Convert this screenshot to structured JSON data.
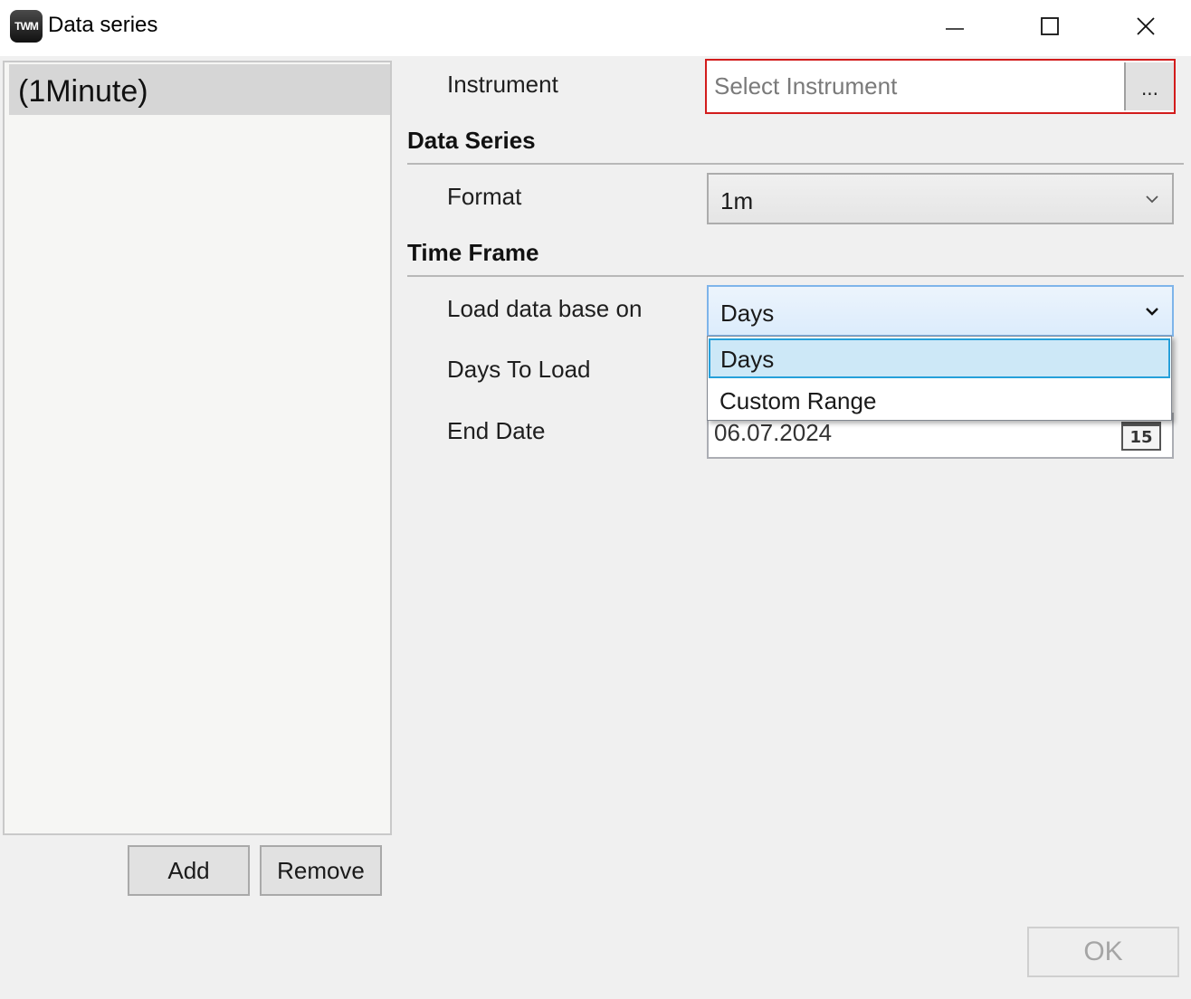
{
  "window": {
    "title": "Data series",
    "app_icon_text": "TWM",
    "controls": [
      "minimize-icon",
      "maximize-icon",
      "close-icon"
    ]
  },
  "series_list": {
    "items": [
      "(1Minute)"
    ],
    "selected_index": 0
  },
  "buttons": {
    "add": "Add",
    "remove": "Remove",
    "ok": "OK",
    "browse": "..."
  },
  "instrument": {
    "label": "Instrument",
    "placeholder": "Select Instrument",
    "value": ""
  },
  "data_series": {
    "heading": "Data Series",
    "format_label": "Format",
    "format_value": "1m"
  },
  "time_frame": {
    "heading": "Time Frame",
    "load_label": "Load data base on",
    "load_value": "Days",
    "days_label": "Days To Load",
    "end_date_label": "End Date",
    "end_date_value": "06.07.2024",
    "calendar_day": "15"
  },
  "dropdown": {
    "options": [
      "Days",
      "Custom Range"
    ],
    "highlighted_index": 0
  },
  "colors": {
    "error_border": "#d21c1c",
    "selection_fill": "#cde8f7",
    "selection_border": "#26a0da"
  }
}
